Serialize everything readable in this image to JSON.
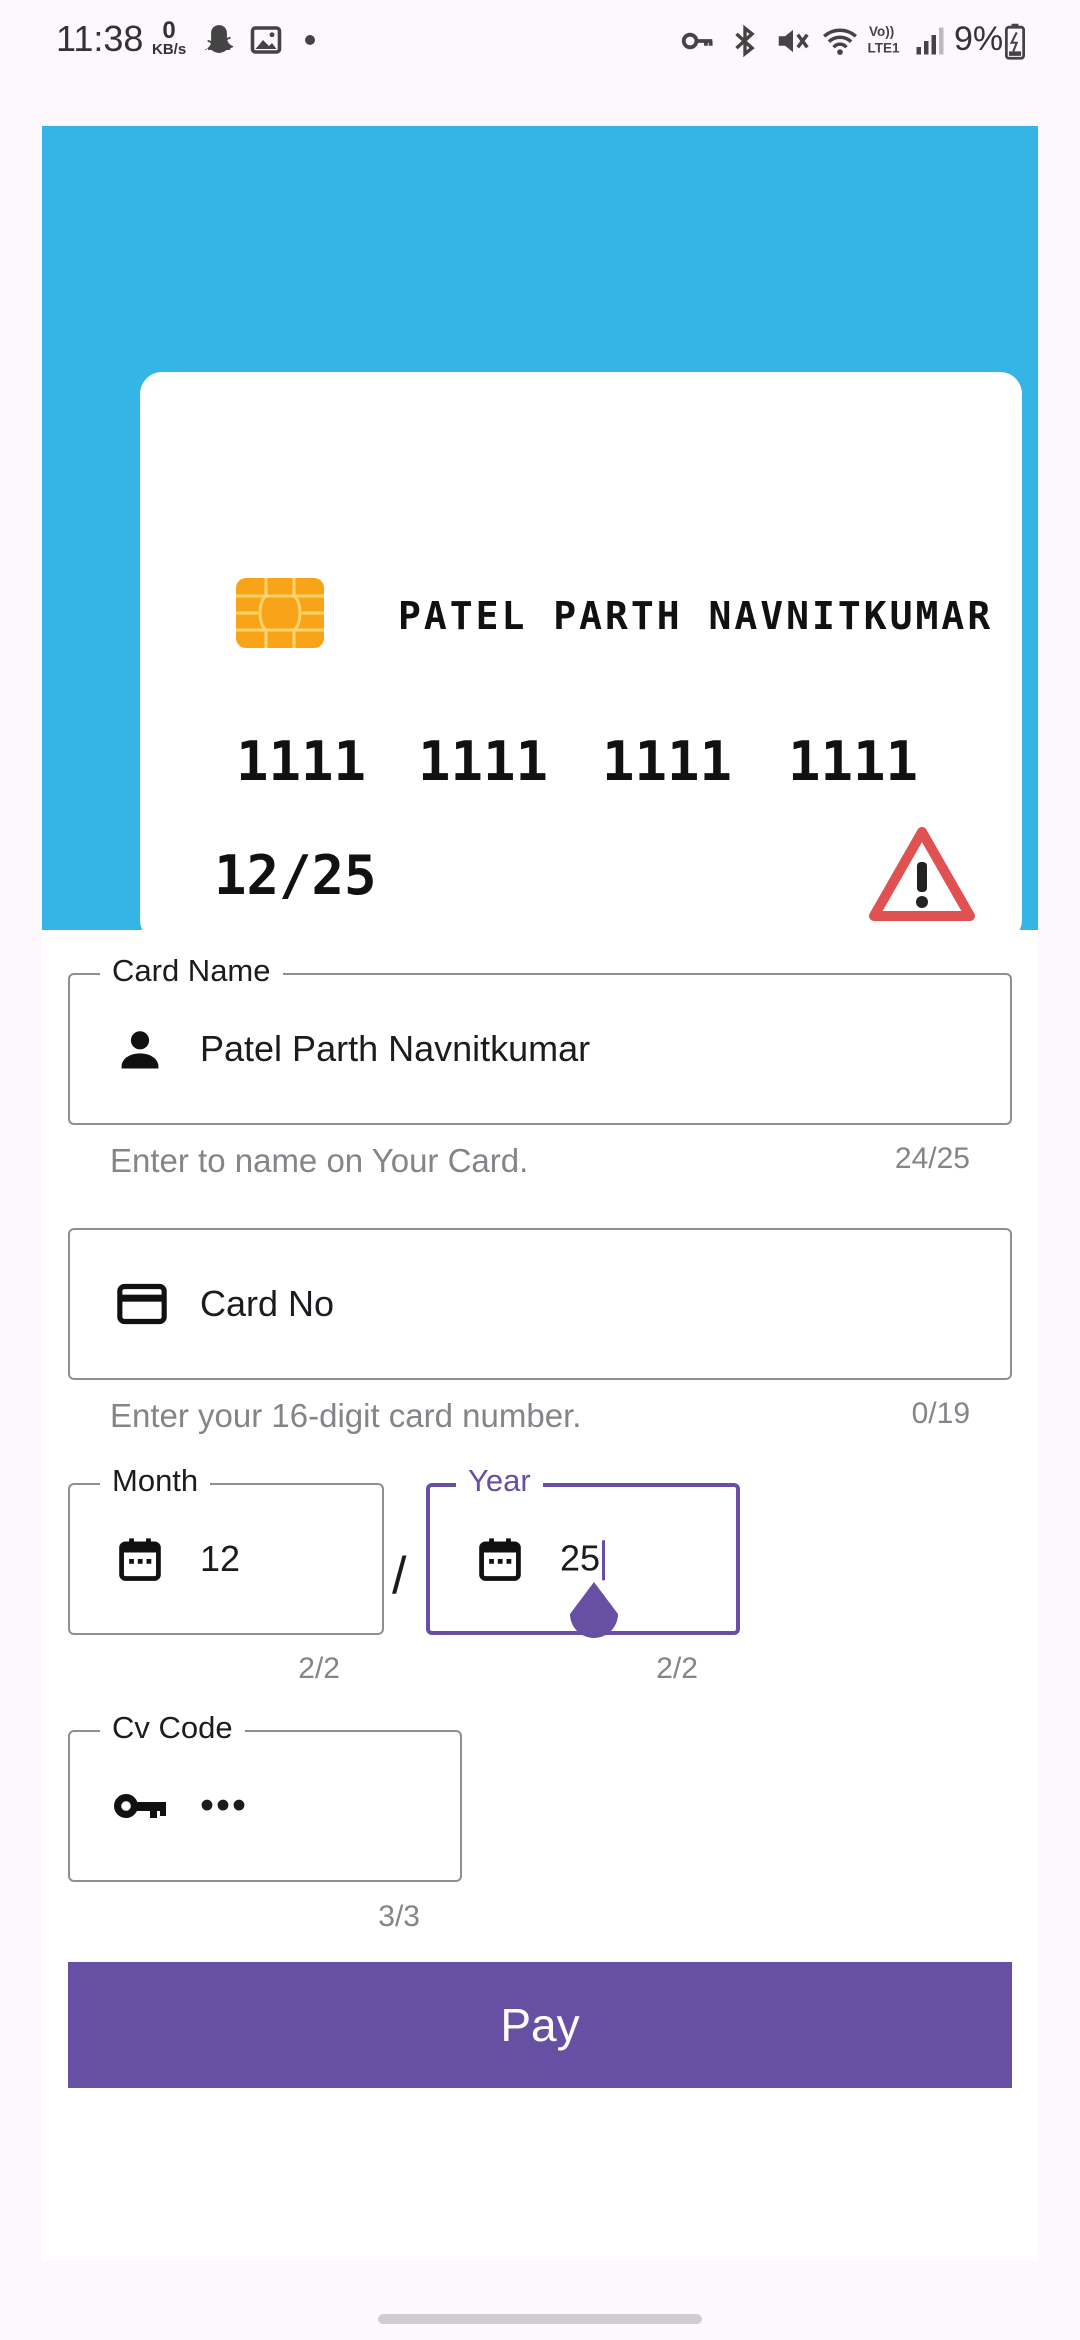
{
  "status_bar": {
    "time": "11:38",
    "net_speed_value": "0",
    "net_speed_unit": "KB/s",
    "battery": "9%"
  },
  "card_preview": {
    "holder_name": "PATEL PARTH NAVNITKUMAR",
    "number_groups": [
      "1111",
      "1111",
      "1111",
      "1111"
    ],
    "expiry": "12/25",
    "colors": {
      "background": "#35b5e5",
      "chip": "#f8a318",
      "warning": "#e05252"
    },
    "icons": {
      "chip": "chip-icon",
      "warning": "warning-icon"
    }
  },
  "form": {
    "card_name": {
      "label": "Card Name",
      "value": "Patel Parth Navnitkumar",
      "helper": "Enter to name on Your Card.",
      "counter": "24/25",
      "icon": "person-icon"
    },
    "card_no": {
      "placeholder": "Card No",
      "helper": "Enter your 16-digit card number.",
      "counter": "0/19",
      "icon": "credit-card-icon"
    },
    "month": {
      "label": "Month",
      "value": "12",
      "counter": "2/2",
      "icon": "calendar-icon"
    },
    "separator": "/",
    "year": {
      "label": "Year",
      "value": "25",
      "counter": "2/2",
      "icon": "calendar-icon"
    },
    "cv_code": {
      "label": "Cv Code",
      "value": "•••",
      "counter": "3/3",
      "icon": "key-icon"
    },
    "pay_label": "Pay",
    "accent_color": "#6750a4"
  }
}
